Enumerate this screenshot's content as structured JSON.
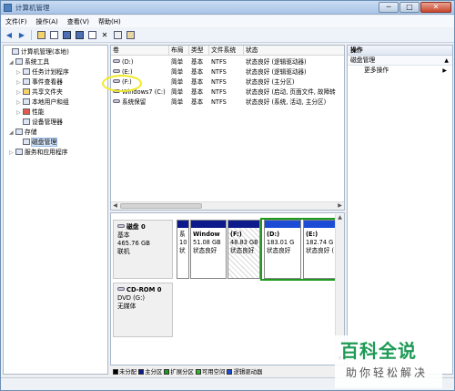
{
  "window": {
    "title": "计算机管理",
    "minimize": "─",
    "maximize": "□",
    "close": "✕"
  },
  "menu": [
    "文件(F)",
    "操作(A)",
    "查看(V)",
    "帮助(H)"
  ],
  "toolbar": {
    "back": "◀",
    "forward": "▶",
    "delete": "✕"
  },
  "tree": [
    {
      "label": "计算机管理(本地)",
      "level": 0,
      "toggle": ""
    },
    {
      "label": "系统工具",
      "level": 1,
      "toggle": "◢"
    },
    {
      "label": "任务计划程序",
      "level": 2,
      "toggle": "▷"
    },
    {
      "label": "事件查看器",
      "level": 2,
      "toggle": "▷"
    },
    {
      "label": "共享文件夹",
      "level": 2,
      "toggle": "▷"
    },
    {
      "label": "本地用户和组",
      "level": 2,
      "toggle": "▷"
    },
    {
      "label": "性能",
      "level": 2,
      "toggle": "▷"
    },
    {
      "label": "设备管理器",
      "level": 2,
      "toggle": ""
    },
    {
      "label": "存储",
      "level": 1,
      "toggle": "◢"
    },
    {
      "label": "磁盘管理",
      "level": 2,
      "toggle": "",
      "selected": true
    },
    {
      "label": "服务和应用程序",
      "level": 1,
      "toggle": "▷"
    }
  ],
  "volume_table": {
    "headers": [
      "卷",
      "布局",
      "类型",
      "文件系统",
      "状态"
    ],
    "rows": [
      [
        "(D:)",
        "简单",
        "基本",
        "NTFS",
        "状态良好 (逻辑驱动器)"
      ],
      [
        "(E:)",
        "简单",
        "基本",
        "NTFS",
        "状态良好 (逻辑驱动器)"
      ],
      [
        "(F:)",
        "简单",
        "基本",
        "NTFS",
        "状态良好 (主分区)"
      ],
      [
        "Windows7 (C:)",
        "简单",
        "基本",
        "NTFS",
        "状态良好 (启动, 页面文件, 故障转"
      ],
      [
        "系统保留",
        "简单",
        "基本",
        "NTFS",
        "状态良好 (系统, 活动, 主分区)"
      ]
    ]
  },
  "disks": [
    {
      "name": "磁盘 0",
      "type": "基本",
      "size": "465.76 GB",
      "status": "联机"
    },
    {
      "name": "CD-ROM 0",
      "type": "DVD (G:)",
      "size": "",
      "status": "无媒体"
    }
  ],
  "partitions": [
    {
      "name": "系",
      "size": "10",
      "status": "状",
      "style": "primary"
    },
    {
      "name": "Window",
      "size": "51.08 GB",
      "status": "状态良好",
      "style": "primary"
    },
    {
      "name": "(F:)",
      "size": "48.83 GB",
      "status": "状态良好",
      "style": "hatch"
    },
    {
      "name": "(D:)",
      "size": "183.01 G",
      "status": "状态良好",
      "style": "logical"
    },
    {
      "name": "(E:)",
      "size": "182.74 G",
      "status": "状态良好 (",
      "style": "logical"
    }
  ],
  "legend": [
    {
      "label": "未分配",
      "color": "#000000"
    },
    {
      "label": "主分区",
      "color": "#0c1a8c"
    },
    {
      "label": "扩展分区",
      "color": "#1d9b1d"
    },
    {
      "label": "可用空间",
      "color": "#2db82d"
    },
    {
      "label": "逻辑驱动器",
      "color": "#1c4cd6"
    }
  ],
  "actions": {
    "header": "操作",
    "section": "磁盘管理",
    "more": "更多操作",
    "collapse": "▲",
    "more_arrow": "▶"
  },
  "watermark": {
    "line1": "百科全说",
    "line2": "助你轻松解决"
  },
  "colors": {
    "title_bar": "#b9d1ee",
    "primary_partition": "#0c1a8c",
    "logical_drive": "#1c4cd6",
    "extended_partition": "#1d9b1d",
    "highlight_circle": "#f2ea25"
  }
}
